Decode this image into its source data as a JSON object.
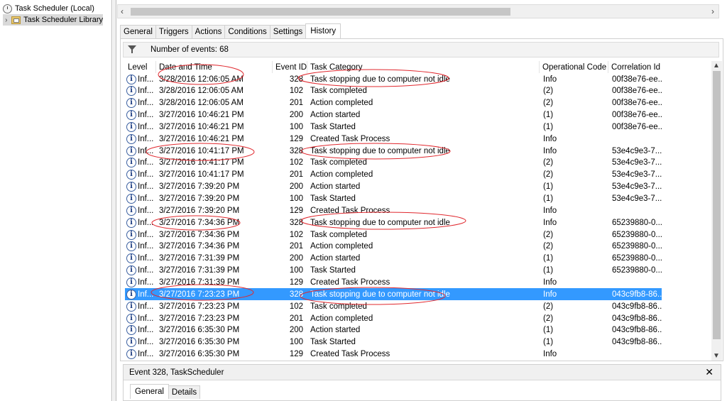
{
  "tree": {
    "root_label": "Task Scheduler (Local)",
    "library_label": "Task Scheduler Library"
  },
  "tabs": [
    "General",
    "Triggers",
    "Actions",
    "Conditions",
    "Settings",
    "History"
  ],
  "active_tab": "History",
  "events_label": "Number of events: 68",
  "columns": [
    "Level",
    "Date and Time",
    "Event ID",
    "Task Category",
    "Operational Code",
    "Correlation Id"
  ],
  "rows": [
    {
      "level": "Inf...",
      "datetime": "3/28/2016 12:06:05 AM",
      "event_id": "328",
      "category": "Task stopping due to computer not idle",
      "opcode": "Info",
      "corr": "00f38e76-ee..."
    },
    {
      "level": "Inf...",
      "datetime": "3/28/2016 12:06:05 AM",
      "event_id": "102",
      "category": "Task completed",
      "opcode": "(2)",
      "corr": "00f38e76-ee..."
    },
    {
      "level": "Inf...",
      "datetime": "3/28/2016 12:06:05 AM",
      "event_id": "201",
      "category": "Action completed",
      "opcode": "(2)",
      "corr": "00f38e76-ee..."
    },
    {
      "level": "Inf...",
      "datetime": "3/27/2016 10:46:21 PM",
      "event_id": "200",
      "category": "Action started",
      "opcode": "(1)",
      "corr": "00f38e76-ee..."
    },
    {
      "level": "Inf...",
      "datetime": "3/27/2016 10:46:21 PM",
      "event_id": "100",
      "category": "Task Started",
      "opcode": "(1)",
      "corr": "00f38e76-ee..."
    },
    {
      "level": "Inf...",
      "datetime": "3/27/2016 10:46:21 PM",
      "event_id": "129",
      "category": "Created Task Process",
      "opcode": "Info",
      "corr": ""
    },
    {
      "level": "Inf...",
      "datetime": "3/27/2016 10:41:17 PM",
      "event_id": "328",
      "category": "Task stopping due to computer not idle",
      "opcode": "Info",
      "corr": "53e4c9e3-7..."
    },
    {
      "level": "Inf...",
      "datetime": "3/27/2016 10:41:17 PM",
      "event_id": "102",
      "category": "Task completed",
      "opcode": "(2)",
      "corr": "53e4c9e3-7..."
    },
    {
      "level": "Inf...",
      "datetime": "3/27/2016 10:41:17 PM",
      "event_id": "201",
      "category": "Action completed",
      "opcode": "(2)",
      "corr": "53e4c9e3-7..."
    },
    {
      "level": "Inf...",
      "datetime": "3/27/2016 7:39:20 PM",
      "event_id": "200",
      "category": "Action started",
      "opcode": "(1)",
      "corr": "53e4c9e3-7..."
    },
    {
      "level": "Inf...",
      "datetime": "3/27/2016 7:39:20 PM",
      "event_id": "100",
      "category": "Task Started",
      "opcode": "(1)",
      "corr": "53e4c9e3-7..."
    },
    {
      "level": "Inf...",
      "datetime": "3/27/2016 7:39:20 PM",
      "event_id": "129",
      "category": "Created Task Process",
      "opcode": "Info",
      "corr": ""
    },
    {
      "level": "Inf...",
      "datetime": "3/27/2016 7:34:36 PM",
      "event_id": "328",
      "category": "Task stopping due to computer not idle",
      "opcode": "Info",
      "corr": "65239880-0..."
    },
    {
      "level": "Inf...",
      "datetime": "3/27/2016 7:34:36 PM",
      "event_id": "102",
      "category": "Task completed",
      "opcode": "(2)",
      "corr": "65239880-0..."
    },
    {
      "level": "Inf...",
      "datetime": "3/27/2016 7:34:36 PM",
      "event_id": "201",
      "category": "Action completed",
      "opcode": "(2)",
      "corr": "65239880-0..."
    },
    {
      "level": "Inf...",
      "datetime": "3/27/2016 7:31:39 PM",
      "event_id": "200",
      "category": "Action started",
      "opcode": "(1)",
      "corr": "65239880-0..."
    },
    {
      "level": "Inf...",
      "datetime": "3/27/2016 7:31:39 PM",
      "event_id": "100",
      "category": "Task Started",
      "opcode": "(1)",
      "corr": "65239880-0..."
    },
    {
      "level": "Inf...",
      "datetime": "3/27/2016 7:31:39 PM",
      "event_id": "129",
      "category": "Created Task Process",
      "opcode": "Info",
      "corr": ""
    },
    {
      "level": "Inf...",
      "datetime": "3/27/2016 7:23:23 PM",
      "event_id": "328",
      "category": "Task stopping due to computer not idle",
      "opcode": "Info",
      "corr": "043c9fb8-86..."
    },
    {
      "level": "Inf...",
      "datetime": "3/27/2016 7:23:23 PM",
      "event_id": "102",
      "category": "Task completed",
      "opcode": "(2)",
      "corr": "043c9fb8-86..."
    },
    {
      "level": "Inf...",
      "datetime": "3/27/2016 7:23:23 PM",
      "event_id": "201",
      "category": "Action completed",
      "opcode": "(2)",
      "corr": "043c9fb8-86..."
    },
    {
      "level": "Inf...",
      "datetime": "3/27/2016 6:35:30 PM",
      "event_id": "200",
      "category": "Action started",
      "opcode": "(1)",
      "corr": "043c9fb8-86..."
    },
    {
      "level": "Inf...",
      "datetime": "3/27/2016 6:35:30 PM",
      "event_id": "100",
      "category": "Task Started",
      "opcode": "(1)",
      "corr": "043c9fb8-86..."
    },
    {
      "level": "Inf...",
      "datetime": "3/27/2016 6:35:30 PM",
      "event_id": "129",
      "category": "Created Task Process",
      "opcode": "Info",
      "corr": ""
    }
  ],
  "selected_row": 18,
  "details": {
    "title": "Event 328, TaskScheduler",
    "tabs": [
      "General",
      "Details"
    ]
  },
  "colors": {
    "selection": "#3399ff",
    "annotation": "#e0282e"
  }
}
